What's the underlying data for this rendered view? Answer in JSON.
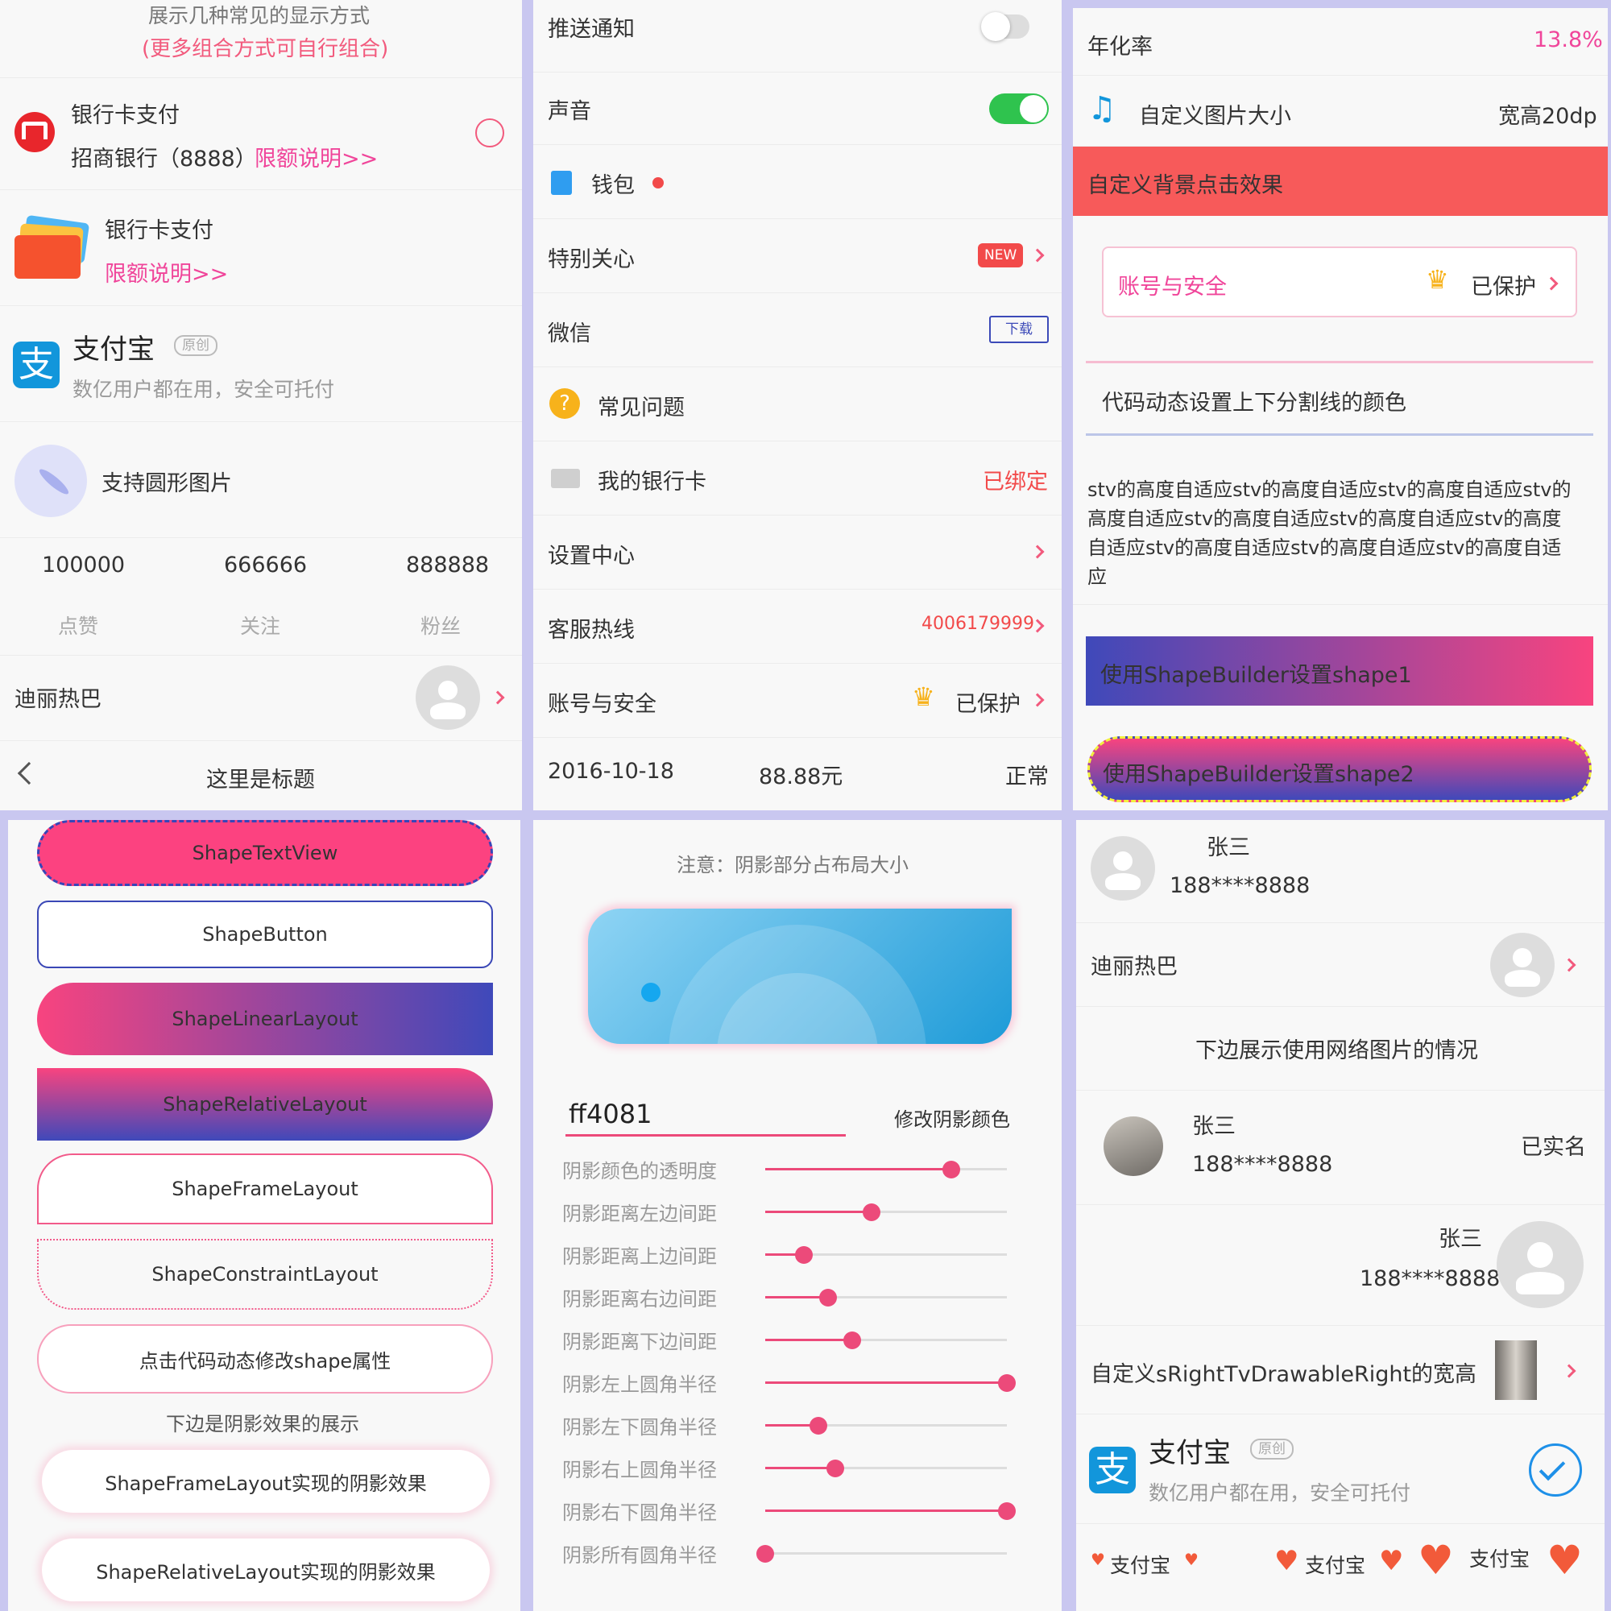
{
  "p1": {
    "intro_title": "展示几种常见的显示方式",
    "intro_sub": "(更多组合方式可自行组合)",
    "bank1": {
      "title": "银行卡支付",
      "bank": "招商银行（8888）",
      "limit": "限额说明>>"
    },
    "bank2": {
      "title": "银行卡支付",
      "limit": "限额说明>>"
    },
    "alipay": {
      "title": "支付宝",
      "badge": "原创",
      "desc": "数亿用户都在用，安全可托付"
    },
    "circle": {
      "label": "支持圆形图片"
    },
    "stats": [
      {
        "value": "100000",
        "label": "点赞"
      },
      {
        "value": "666666",
        "label": "关注"
      },
      {
        "value": "888888",
        "label": "粉丝"
      }
    ],
    "user": {
      "name": "迪丽热巴"
    },
    "titlebar": {
      "title": "这里是标题"
    }
  },
  "p2": {
    "push": "推送通知",
    "sound": "声音",
    "wallet": "钱包",
    "special": "特别关心",
    "new_badge": "NEW",
    "wechat": "微信",
    "download": "下载",
    "faq": "常见问题",
    "bankcard": "我的银行卡",
    "bound": "已绑定",
    "settings": "设置中心",
    "hotline": "客服热线",
    "hotline_num": "4006179999",
    "account": "账号与安全",
    "protected": "已保护",
    "date": "2016-10-18",
    "amount": "88.88元",
    "status": "正常",
    "push_on": false,
    "sound_on": true
  },
  "p3": {
    "rate_label": "年化率",
    "rate_value": "13.8%",
    "img_label": "自定义图片大小",
    "img_value": "宽高20dp",
    "bg_click": "自定义背景点击效果",
    "account": "账号与安全",
    "protected": "已保护",
    "divider_label": "代码动态设置上下分割线的颜色",
    "long_text": "stv的高度自适应stv的高度自适应stv的高度自适应stv的高度自适应stv的高度自适应stv的高度自适应stv的高度自适应stv的高度自适应stv的高度自适应stv的高度自适应",
    "shape1": "使用ShapeBuilder设置shape1",
    "shape2": "使用ShapeBuilder设置shape2"
  },
  "p4": {
    "buttons": [
      "ShapeTextView",
      "ShapeButton",
      "ShapeLinearLayout",
      "ShapeRelativeLayout",
      "ShapeFrameLayout",
      "ShapeConstraintLayout",
      "点击代码动态修改shape属性"
    ],
    "shadow_caption": "下边是阴影效果的展示",
    "shadow_frame": "ShapeFrameLayout实现的阴影效果",
    "shadow_relative": "ShapeRelativeLayout实现的阴影效果"
  },
  "p5": {
    "note": "注意：阴影部分占布局大小",
    "color_value": "ff4081",
    "color_button": "修改阴影颜色",
    "sliders": [
      {
        "label": "阴影颜色的透明度",
        "value": 0.77
      },
      {
        "label": "阴影距离左边间距",
        "value": 0.44
      },
      {
        "label": "阴影距离上边间距",
        "value": 0.16
      },
      {
        "label": "阴影距离右边间距",
        "value": 0.26
      },
      {
        "label": "阴影距离下边间距",
        "value": 0.36
      },
      {
        "label": "阴影左上圆角半径",
        "value": 1.0
      },
      {
        "label": "阴影左下圆角半径",
        "value": 0.22
      },
      {
        "label": "阴影右上圆角半径",
        "value": 0.29
      },
      {
        "label": "阴影右下圆角半径",
        "value": 1.0
      },
      {
        "label": "阴影所有圆角半径",
        "value": 0.0
      }
    ]
  },
  "p6": {
    "u1": {
      "name": "张三",
      "phone": "188****8888"
    },
    "u2": {
      "name": "迪丽热巴"
    },
    "net_caption": "下边展示使用网络图片的情况",
    "u3": {
      "name": "张三",
      "phone": "188****8888",
      "status": "已实名"
    },
    "u4": {
      "name": "张三",
      "phone": "188****8888"
    },
    "custom": "自定义sRightTvDrawableRight的宽高",
    "alipay": {
      "title": "支付宝",
      "badge": "原创",
      "desc": "数亿用户都在用，安全可托付"
    },
    "hearts": [
      "支付宝",
      "支付宝",
      "支付宝"
    ]
  },
  "colors": {
    "accent": "#f0459a",
    "red": "#f24a4a",
    "green": "#2fc34e",
    "blue": "#1296db",
    "bg_click": "#f75a5a"
  }
}
